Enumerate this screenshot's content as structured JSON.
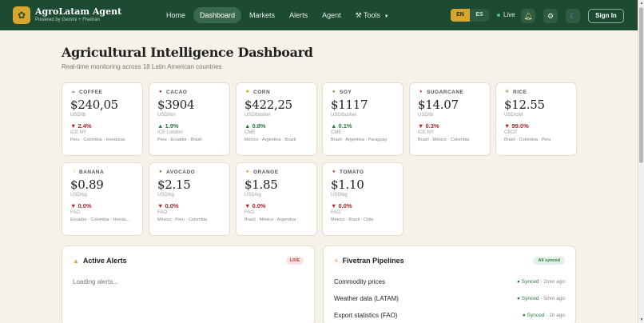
{
  "brand": {
    "title": "AgroLatam Agent",
    "subtitle": "Powered by Gemini + Fivetran",
    "logo_icon": "wheat-icon"
  },
  "nav": [
    {
      "label": "Home",
      "active": false
    },
    {
      "label": "Dashboard",
      "active": true
    },
    {
      "label": "Markets",
      "active": false
    },
    {
      "label": "Alerts",
      "active": false
    },
    {
      "label": "Agent",
      "active": false
    },
    {
      "label": "Tools",
      "active": false,
      "icon": "wrench-icon",
      "dropdown": true
    }
  ],
  "lang": {
    "en": "EN",
    "es": "ES",
    "selected": "EN"
  },
  "live_label": "Live",
  "signin_label": "Sign In",
  "page": {
    "title": "Agricultural Intelligence Dashboard",
    "subtitle": "Real-time monitoring across 18 Latin American countries"
  },
  "commodities": [
    {
      "name": "COFFEE",
      "icon": "coffee-icon",
      "glyph": "☕",
      "price": "$240,05",
      "unit": "USD/lb",
      "change": "▼ 2.4%",
      "direction": "down",
      "exchange": "ICE NY",
      "countries": "Peru · Colombia · Honduras"
    },
    {
      "name": "CACAO",
      "icon": "cacao-icon",
      "glyph": "●",
      "price": "$3904",
      "unit": "USD/ton",
      "change": "▲ 1.9%",
      "direction": "up",
      "exchange": "ICE London",
      "countries": "Peru · Ecuador · Brazil"
    },
    {
      "name": "CORN",
      "icon": "corn-icon",
      "glyph": "♣",
      "price": "$422,25",
      "unit": "USD/bushel",
      "change": "▲ 0.8%",
      "direction": "up",
      "exchange": "CME",
      "countries": "México · Argentina · Brazil"
    },
    {
      "name": "SOY",
      "icon": "soy-icon",
      "glyph": "♠",
      "price": "$1117",
      "unit": "USD/bushel",
      "change": "▲ 0.1%",
      "direction": "up",
      "exchange": "CME",
      "countries": "Brazil · Argentina · Paraguay"
    },
    {
      "name": "SUGARCANE",
      "icon": "sugarcane-icon",
      "glyph": "♦",
      "price": "$14.07",
      "unit": "USD/lb",
      "change": "▼ 0.3%",
      "direction": "down",
      "exchange": "ICE NY",
      "countries": "Brazil · México · Colombia"
    },
    {
      "name": "RICE",
      "icon": "rice-icon",
      "glyph": "❀",
      "price": "$12.55",
      "unit": "USD/cwt",
      "change": "▼ 99.0%",
      "direction": "down",
      "exchange": "CBOT",
      "countries": "Brazil · Colombia · Peru"
    },
    {
      "name": "BANANA",
      "icon": "banana-icon",
      "glyph": "☽",
      "price": "$0.89",
      "unit": "USD/kg",
      "change": "▼ 0.0%",
      "direction": "down",
      "exchange": "FAO",
      "countries": "Ecuador · Colombia · Hondu..."
    },
    {
      "name": "AVOCADO",
      "icon": "avocado-icon",
      "glyph": "●",
      "price": "$2.15",
      "unit": "USD/kg",
      "change": "▼ 0.0%",
      "direction": "down",
      "exchange": "FAO",
      "countries": "México · Peru · Colombia"
    },
    {
      "name": "ORANGE",
      "icon": "orange-icon",
      "glyph": "●",
      "price": "$1.85",
      "unit": "USD/kg",
      "change": "▼ 0.0%",
      "direction": "down",
      "exchange": "FAO",
      "countries": "Brazil · México · Argentina"
    },
    {
      "name": "TOMATO",
      "icon": "tomato-icon",
      "glyph": "●",
      "price": "$1.10",
      "unit": "USD/kg",
      "change": "▼ 0.0%",
      "direction": "down",
      "exchange": "FAO",
      "countries": "México · Brazil · Chile"
    }
  ],
  "alerts": {
    "title": "Active Alerts",
    "badge": "LIVE",
    "loading": "Loading alerts..."
  },
  "pipelines": {
    "title": "Fivetran Pipelines",
    "badge": "All synced",
    "rows": [
      {
        "name": "Commodity prices",
        "status": "Synced",
        "time": "2min ago"
      },
      {
        "name": "Weather data (LATAM)",
        "status": "Synced",
        "time": "5min ago"
      },
      {
        "name": "Export statistics (FAO)",
        "status": "Synced",
        "time": "1h ago"
      }
    ]
  },
  "colors": {
    "header_bg": "#1c4a33",
    "accent_gold": "#d9a531",
    "up_green": "#2c7a45",
    "down_red": "#a9262a",
    "page_bg": "#f6f2ea"
  }
}
